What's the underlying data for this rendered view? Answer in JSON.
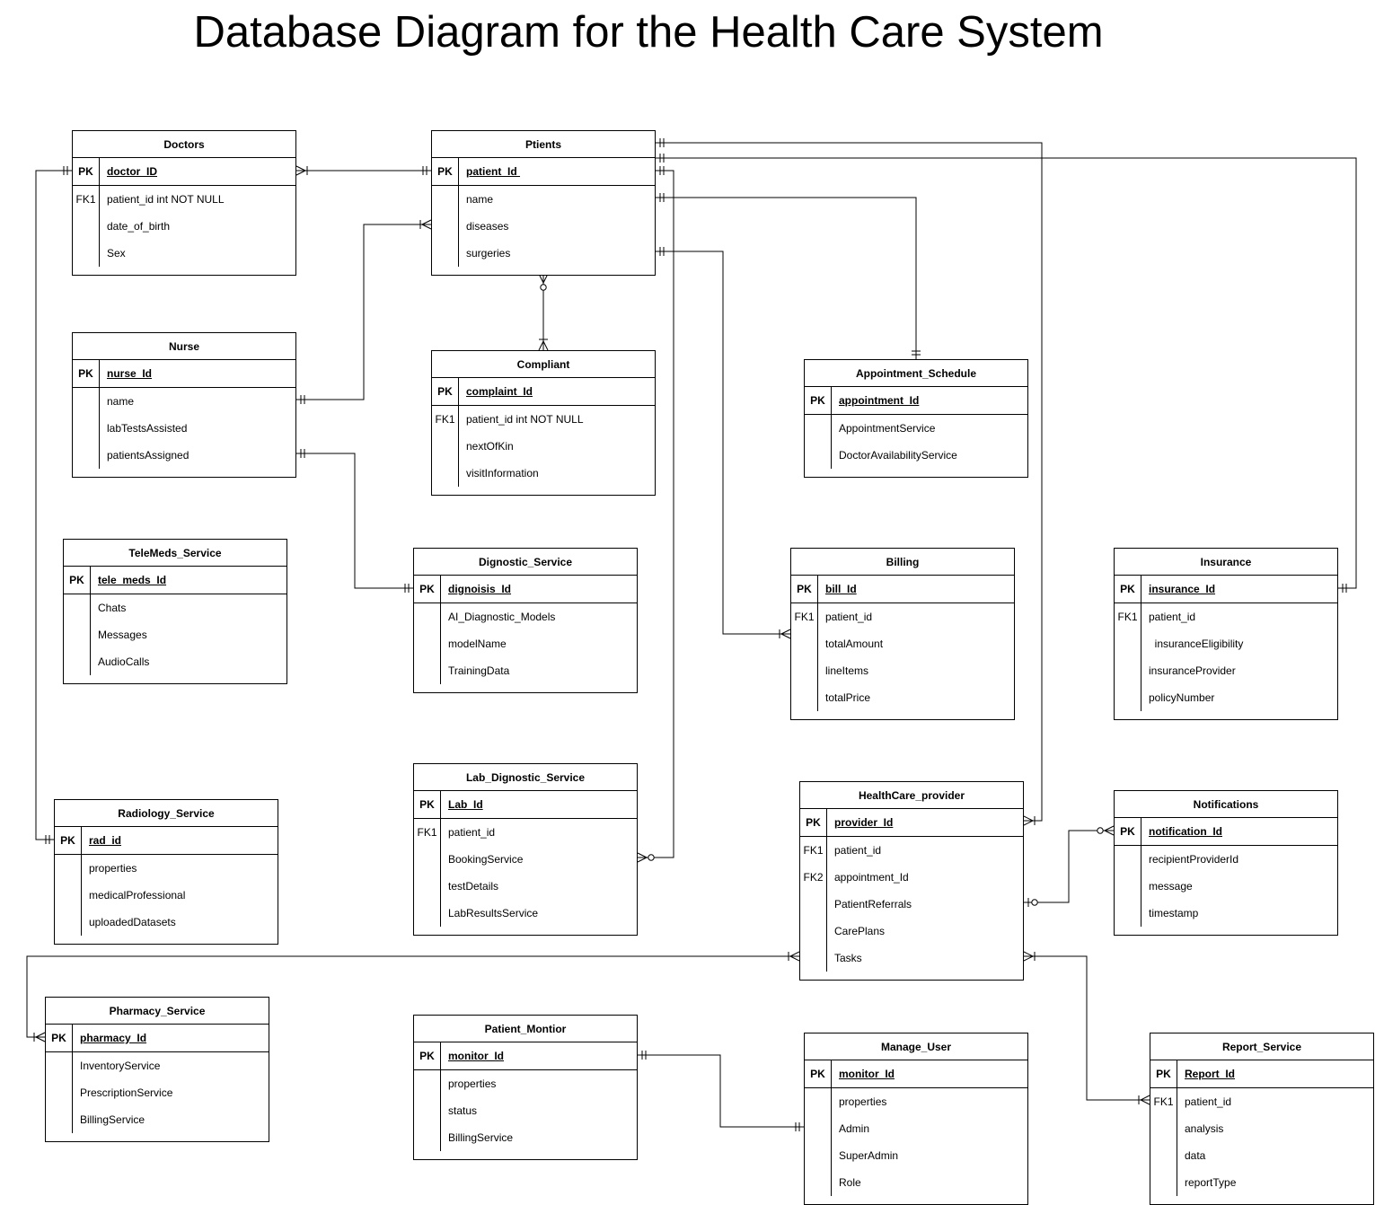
{
  "title": "Database Diagram for the Health Care System",
  "entities": [
    {
      "id": "doctors",
      "name": "Doctors",
      "rows": [
        [
          "PK",
          "doctor_ID"
        ],
        [
          "FK1",
          "patient_id int NOT NULL"
        ],
        [
          "",
          "date_of_birth"
        ],
        [
          "",
          "Sex"
        ]
      ]
    },
    {
      "id": "ptients",
      "name": "Ptients",
      "rows": [
        [
          "PK",
          "patient_Id "
        ],
        [
          "",
          "name"
        ],
        [
          "",
          "diseases"
        ],
        [
          "",
          "surgeries"
        ]
      ]
    },
    {
      "id": "nurse",
      "name": "Nurse",
      "rows": [
        [
          "PK",
          "nurse_Id"
        ],
        [
          "",
          "name"
        ],
        [
          "",
          "labTestsAssisted"
        ],
        [
          "",
          "patientsAssigned"
        ]
      ]
    },
    {
      "id": "compliant",
      "name": "Compliant",
      "rows": [
        [
          "PK",
          "complaint_Id"
        ],
        [
          "FK1",
          "patient_id int NOT NULL"
        ],
        [
          "",
          "nextOfKin"
        ],
        [
          "",
          "visitInformation"
        ]
      ]
    },
    {
      "id": "appointment",
      "name": "Appointment_Schedule",
      "rows": [
        [
          "PK",
          "appointment_Id"
        ],
        [
          "",
          "AppointmentService"
        ],
        [
          "",
          "DoctorAvailabilityService"
        ]
      ]
    },
    {
      "id": "telemeds",
      "name": "TeleMeds_Service",
      "rows": [
        [
          "PK",
          "tele_meds_Id"
        ],
        [
          "",
          "Chats"
        ],
        [
          "",
          "Messages"
        ],
        [
          "",
          "AudioCalls"
        ]
      ]
    },
    {
      "id": "dignostic",
      "name": "Dignostic_Service",
      "rows": [
        [
          "PK",
          "dignoisis_Id"
        ],
        [
          "",
          "AI_Diagnostic_Models"
        ],
        [
          "",
          "modelName"
        ],
        [
          "",
          "TrainingData"
        ]
      ]
    },
    {
      "id": "billing",
      "name": "Billing",
      "rows": [
        [
          "PK",
          "bill_Id"
        ],
        [
          "FK1",
          "patient_id"
        ],
        [
          "",
          "totalAmount"
        ],
        [
          "",
          "lineItems"
        ],
        [
          "",
          "totalPrice"
        ]
      ]
    },
    {
      "id": "insurance",
      "name": "Insurance",
      "rows": [
        [
          "PK",
          "insurance_Id"
        ],
        [
          "FK1",
          "patient_id"
        ],
        [
          "",
          "  insuranceEligibility"
        ],
        [
          "",
          "insuranceProvider"
        ],
        [
          "",
          "policyNumber"
        ]
      ]
    },
    {
      "id": "lab",
      "name": "Lab_Dignostic_Service",
      "rows": [
        [
          "PK",
          "Lab_Id"
        ],
        [
          "FK1",
          "patient_id"
        ],
        [
          "",
          "BookingService"
        ],
        [
          "",
          "testDetails"
        ],
        [
          "",
          "LabResultsService"
        ]
      ]
    },
    {
      "id": "provider",
      "name": "HealthCare_provider",
      "rows": [
        [
          "PK",
          "provider_Id"
        ],
        [
          "FK1",
          "patient_id"
        ],
        [
          "FK2",
          "appointment_Id"
        ],
        [
          "",
          "PatientReferrals"
        ],
        [
          "",
          "CarePlans"
        ],
        [
          "",
          "Tasks"
        ]
      ]
    },
    {
      "id": "notifications",
      "name": "Notifications",
      "rows": [
        [
          "PK",
          "notification_Id"
        ],
        [
          "",
          "recipientProviderId"
        ],
        [
          "",
          "message"
        ],
        [
          "",
          "timestamp"
        ]
      ]
    },
    {
      "id": "radiology",
      "name": "Radiology_Service",
      "rows": [
        [
          "PK",
          "rad_id"
        ],
        [
          "",
          "properties"
        ],
        [
          "",
          "medicalProfessional"
        ],
        [
          "",
          "uploadedDatasets"
        ]
      ]
    },
    {
      "id": "pharmacy",
      "name": "Pharmacy_Service",
      "rows": [
        [
          "PK",
          "pharmacy_Id"
        ],
        [
          "",
          "InventoryService"
        ],
        [
          "",
          "PrescriptionService"
        ],
        [
          "",
          "BillingService"
        ]
      ]
    },
    {
      "id": "monitor",
      "name": "Patient_Montior",
      "rows": [
        [
          "PK",
          "monitor_Id"
        ],
        [
          "",
          "properties"
        ],
        [
          "",
          "status"
        ],
        [
          "",
          "BillingService"
        ]
      ]
    },
    {
      "id": "manage_user",
      "name": "Manage_User",
      "rows": [
        [
          "PK",
          "monitor_Id"
        ],
        [
          "",
          "properties"
        ],
        [
          "",
          "Admin"
        ],
        [
          "",
          "SuperAdmin"
        ],
        [
          "",
          "Role"
        ]
      ]
    },
    {
      "id": "report",
      "name": "Report_Service",
      "rows": [
        [
          "PK",
          "Report_Id"
        ],
        [
          "FK1",
          "patient_id"
        ],
        [
          "",
          "analysis"
        ],
        [
          "",
          "data"
        ],
        [
          "",
          "reportType"
        ]
      ]
    }
  ],
  "relationships": [
    {
      "from": "doctors",
      "to": "ptients",
      "from_end": "one-or-many",
      "to_end": "one-or-many"
    },
    {
      "from": "nurse",
      "to": "ptients",
      "from_end": "one-and-only-one",
      "to_end": "one-or-many"
    },
    {
      "from": "ptients",
      "to": "compliant",
      "from_end": "zero-or-many",
      "to_end": "one-or-many"
    },
    {
      "from": "ptients",
      "to": "appointment",
      "from_end": "one-and-only-one",
      "to_end": "one-and-only-one"
    },
    {
      "from": "ptients",
      "to": "billing",
      "from_end": "one-and-only-one",
      "to_end": "one-or-many"
    },
    {
      "from": "ptients",
      "to": "insurance",
      "from_end": "one-and-only-one",
      "to_end": "one-and-only-one"
    },
    {
      "from": "ptients",
      "to": "provider",
      "from_end": "one-and-only-one",
      "to_end": "one-or-many"
    },
    {
      "from": "ptients",
      "to": "lab",
      "from_end": "one-and-only-one",
      "to_end": "zero-or-many"
    },
    {
      "from": "nurse",
      "to": "dignostic",
      "from_end": "one-and-only-one",
      "to_end": "one-and-only-one"
    },
    {
      "from": "doctors",
      "to": "radiology",
      "from_end": "one-and-only-one",
      "to_end": "one-and-only-one"
    },
    {
      "from": "provider",
      "to": "notifications",
      "from_end": "zero-or-one",
      "to_end": "zero-or-many"
    },
    {
      "from": "provider",
      "to": "pharmacy",
      "from_end": "one-or-many",
      "to_end": "one-or-many"
    },
    {
      "from": "provider",
      "to": "report",
      "from_end": "one-or-many",
      "to_end": "one-or-many"
    },
    {
      "from": "monitor",
      "to": "manage_user",
      "from_end": "one-and-only-one",
      "to_end": "one-and-only-one"
    }
  ]
}
